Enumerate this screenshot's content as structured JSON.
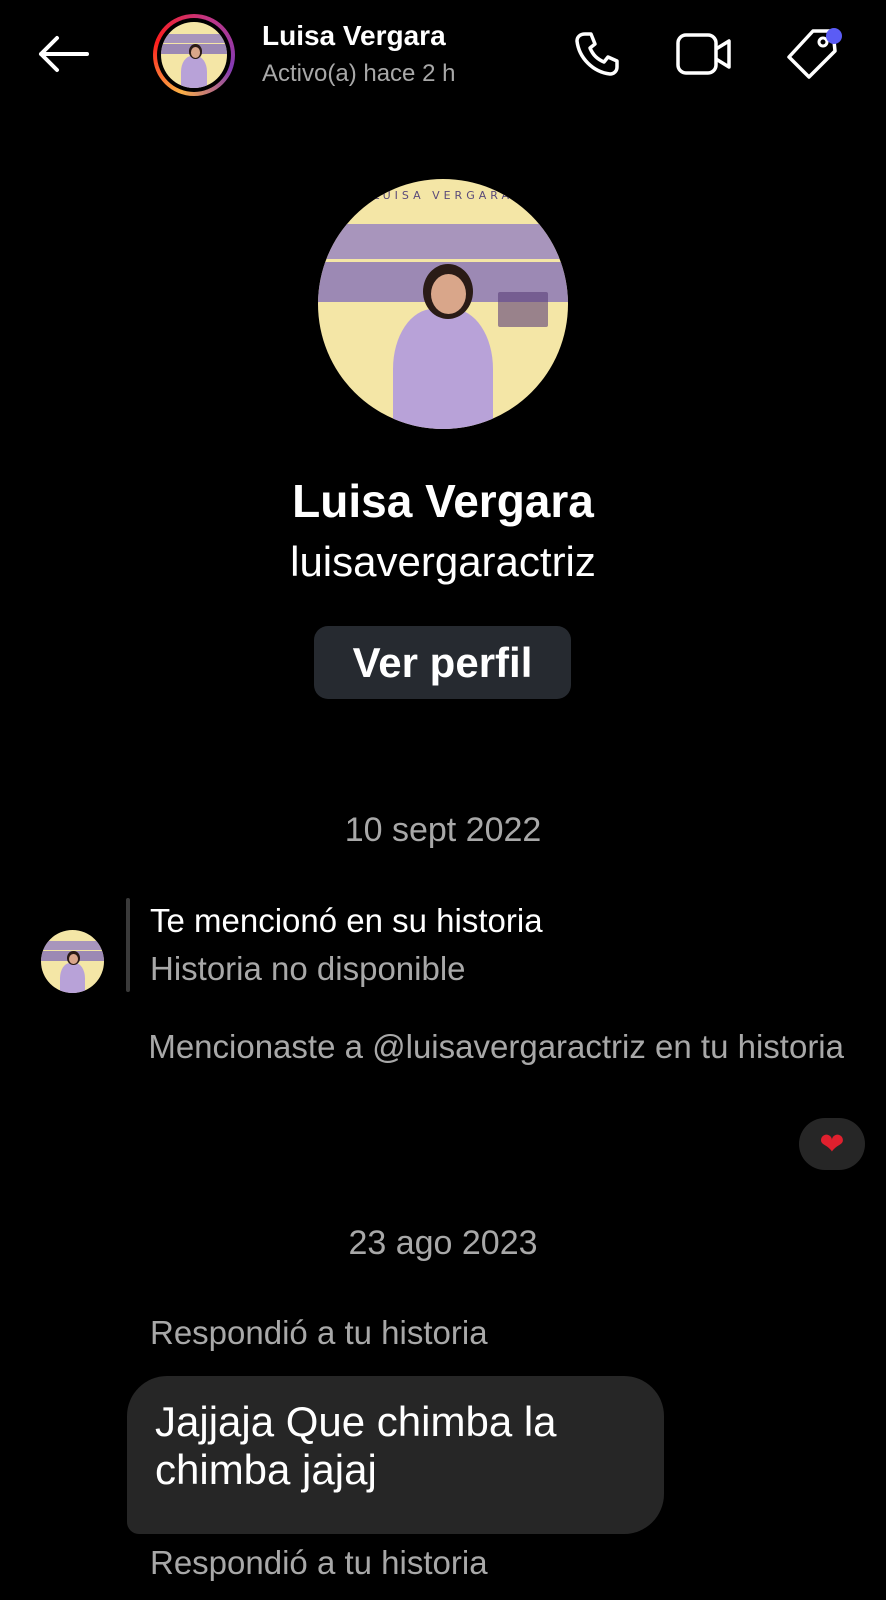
{
  "header": {
    "name": "Luisa Vergara",
    "status": "Activo(a) hace 2 h",
    "back_icon": "arrow-left-icon",
    "call_icon": "phone-icon",
    "video_icon": "video-camera-icon",
    "tag_icon": "tag-icon",
    "notification_dot_color": "#5b5cf5"
  },
  "profile": {
    "photo_text": "LUISA VERGARA",
    "name": "Luisa Vergara",
    "username": "luisavergaractriz",
    "view_profile_label": "Ver perfil"
  },
  "thread": [
    {
      "date": "10 sept 2022",
      "mention_title": "Te mencionó en su historia",
      "mention_sub": "Historia no disponible",
      "mentioned_you_text": "Mencionaste a @luisavergaractriz en tu historia",
      "reaction": "❤"
    },
    {
      "date": "23 ago 2023",
      "replied_label": "Respondió a tu historia",
      "message": "Jajjaja Que chimba la chimba jajaj",
      "replied_label_2": "Respondió a tu historia"
    }
  ]
}
